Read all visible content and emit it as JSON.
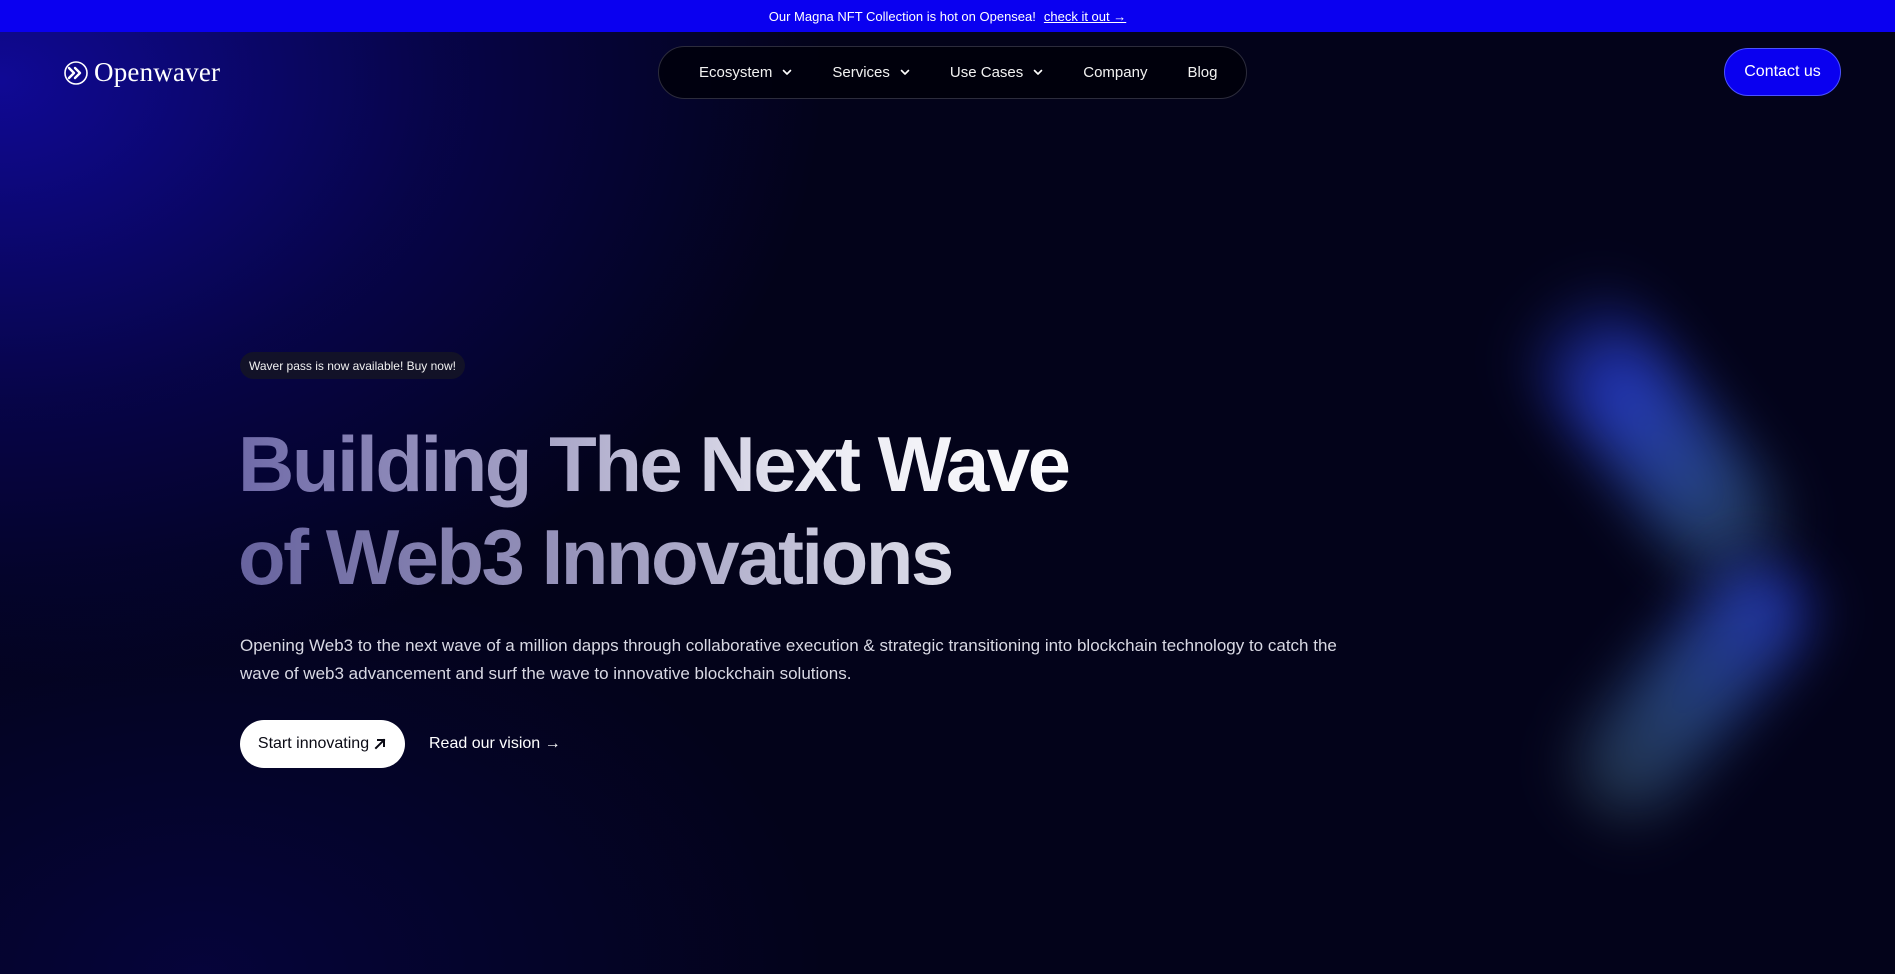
{
  "announcement": {
    "text": "Our Magna NFT Collection is hot on Opensea!",
    "link_label": "check it out →"
  },
  "brand": {
    "name": "Openwaver",
    "logo_icon": "chevrons-logo-icon"
  },
  "nav": {
    "items": [
      {
        "label": "Ecosystem",
        "has_dropdown": true
      },
      {
        "label": "Services",
        "has_dropdown": true
      },
      {
        "label": "Use Cases",
        "has_dropdown": true
      },
      {
        "label": "Company",
        "has_dropdown": false
      },
      {
        "label": "Blog",
        "has_dropdown": false
      }
    ]
  },
  "header": {
    "contact_label": "Contact us"
  },
  "hero": {
    "badge": "Waver pass is now available! Buy now!",
    "headline_line1": "Building The Next Wave",
    "headline_line2": "of Web3 Innovations",
    "description": "Opening Web3 to the next wave of a million dapps through collaborative execution & strategic transitioning into blockchain technology to catch the wave of web3 advancement and surf the wave to innovative blockchain solutions.",
    "primary_cta": "Start innovating",
    "secondary_cta": "Read our vision →"
  },
  "colors": {
    "accent": "#0a00f0",
    "background": "#03031a",
    "text": "#ffffff"
  }
}
